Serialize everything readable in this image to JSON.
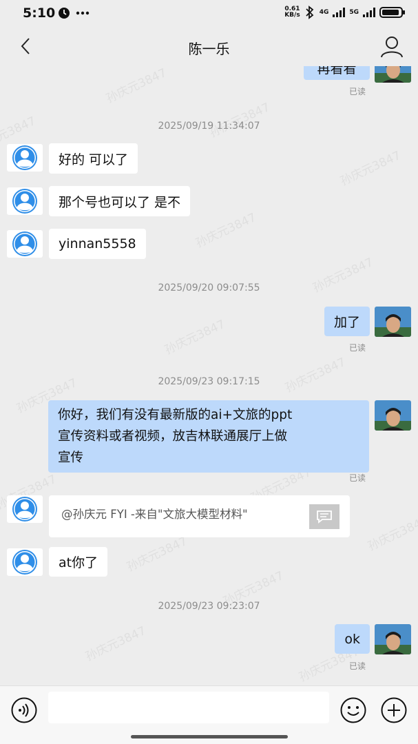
{
  "status_bar": {
    "time": "5:10",
    "net_speed_value": "0.61",
    "net_speed_unit": "KB/s",
    "network_1": "4G",
    "network_2": "5G"
  },
  "header": {
    "title": "陈一乐"
  },
  "watermark": "孙庆元3847",
  "messages": [
    {
      "id": "m0",
      "side": "right",
      "text": "再看看",
      "read": "已读"
    },
    {
      "id": "t1",
      "timestamp": "2025/09/19 11:34:07"
    },
    {
      "id": "m1",
      "side": "left",
      "text": "好的 可以了"
    },
    {
      "id": "m2",
      "side": "left",
      "text": "那个号也可以了 是不"
    },
    {
      "id": "m3",
      "side": "left",
      "text": "yinnan5558"
    },
    {
      "id": "t2",
      "timestamp": "2025/09/20 09:07:55"
    },
    {
      "id": "m4",
      "side": "right",
      "text": "加了",
      "read": "已读"
    },
    {
      "id": "t3",
      "timestamp": "2025/09/23 09:17:15"
    },
    {
      "id": "m5",
      "side": "right",
      "lines": [
        "你好，我们有没有最新版的ai+文旅的ppt",
        "宣传资料或者视频，放吉林联通展厅上做",
        "宣传"
      ],
      "read": "已读"
    },
    {
      "id": "m6",
      "side": "left",
      "type": "card",
      "text": "@孙庆元 FYI -来自\"文旅大模型材料\""
    },
    {
      "id": "m7",
      "side": "left",
      "text": "at你了"
    },
    {
      "id": "t4",
      "timestamp": "2025/09/23 09:23:07"
    },
    {
      "id": "m8",
      "side": "right",
      "text": "ok",
      "read": "已读"
    }
  ],
  "input": {
    "value": "",
    "placeholder": ""
  },
  "icons": {
    "back": "chevron-left-icon",
    "profile": "person-icon",
    "voice": "voice-icon",
    "emoji": "smile-icon",
    "add": "plus-icon",
    "avatar_default": "default-user-avatar-icon",
    "card": "message-icon"
  },
  "colors": {
    "background": "#ededed",
    "bubble_self": "#bdd9fb",
    "bubble_other": "#ffffff",
    "avatar_blue": "#2f8ee8",
    "muted_text": "#8c8c8c"
  }
}
